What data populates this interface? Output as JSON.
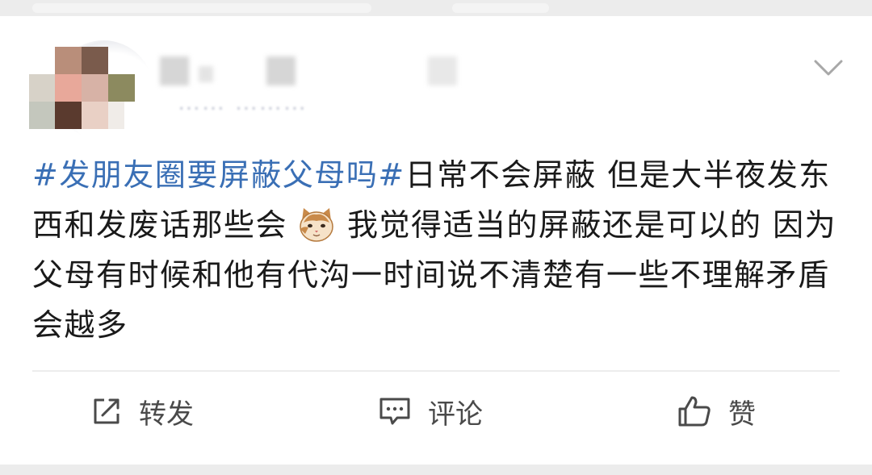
{
  "post": {
    "author_name": "",
    "meta": "…… ………",
    "topic": "#发朋友圈要屏蔽父母吗#",
    "text_part1": "日常不会屏蔽 但是大半夜发东西和发废话那些会",
    "emoji_icon": "cat-face-emoji",
    "text_part2": "我觉得适当的屏蔽还是可以的 因为父母有时候和他有代沟一时间说不清楚有一些不理解矛盾会越多"
  },
  "actions": {
    "repost_label": "转发",
    "comment_label": "评论",
    "like_label": "赞"
  },
  "colors": {
    "topic": "#3a6fb5",
    "text": "#1a1a1a",
    "action": "#4a4a4a"
  }
}
